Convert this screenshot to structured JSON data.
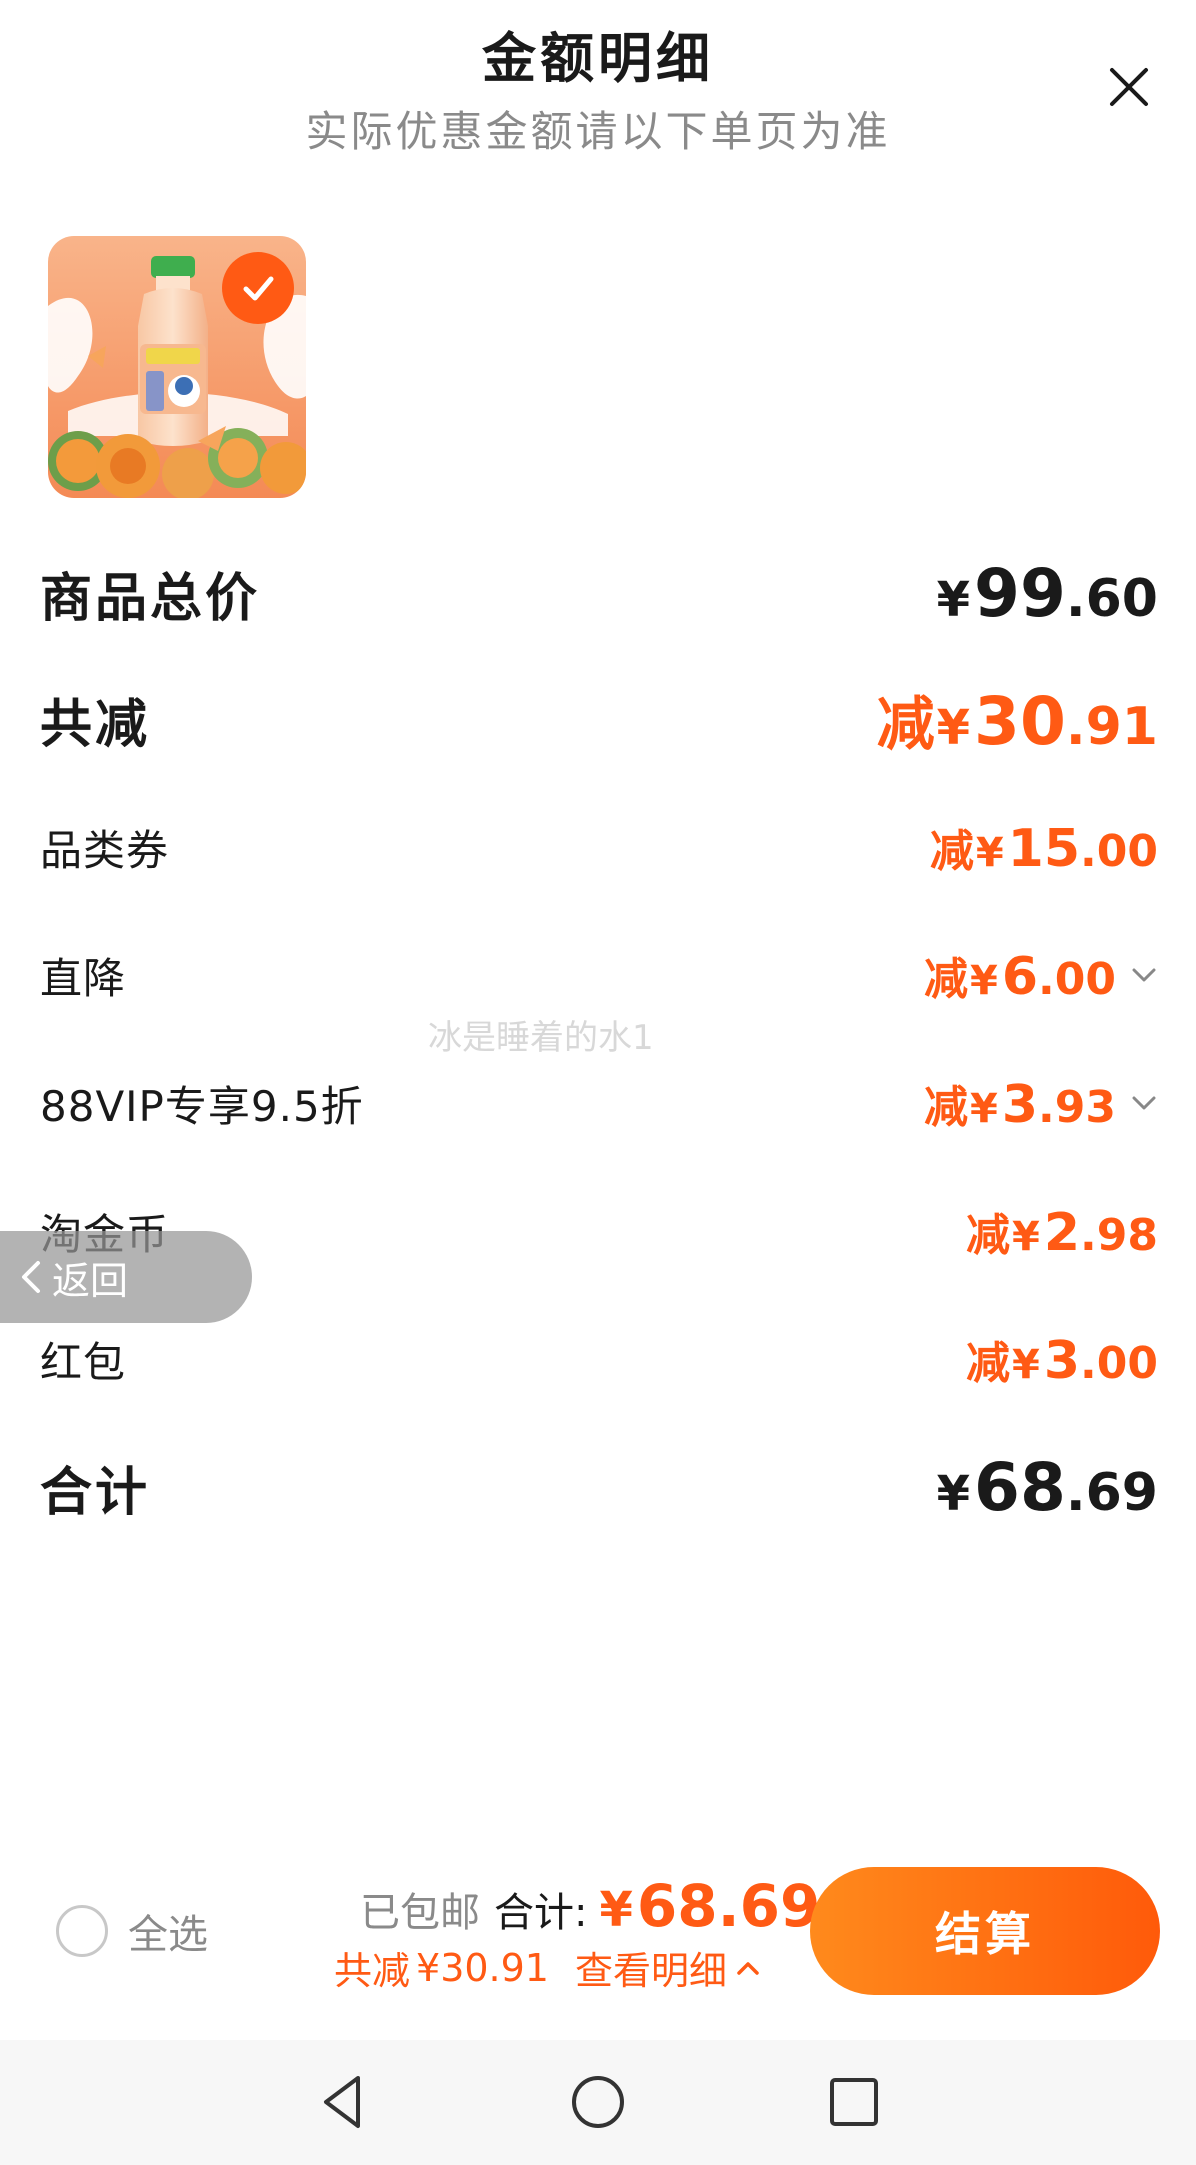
{
  "header": {
    "title": "金额明细",
    "subtitle": "实际优惠金额请以下单页为准",
    "close_icon": "close-icon"
  },
  "product": {
    "image_icon": "melon-milk-drink-image",
    "selected": true
  },
  "rows": {
    "subtotal": {
      "label": "商品总价",
      "currency": "¥",
      "int": "99",
      "dec": ".60"
    },
    "discount_total": {
      "label": "共减",
      "prefix": "减",
      "currency": "¥",
      "int": "30",
      "dec": ".91"
    },
    "category_coupon": {
      "label": "品类券",
      "prefix": "减",
      "currency": "¥",
      "int": "15",
      "dec": ".00"
    },
    "direct_discount": {
      "label": "直降",
      "prefix": "减",
      "currency": "¥",
      "int": "6",
      "dec": ".00"
    },
    "vip_discount": {
      "label": "88VIP专享9.5折",
      "prefix": "减",
      "currency": "¥",
      "int": "3",
      "dec": ".93"
    },
    "coins": {
      "label": "淘金币",
      "prefix": "减",
      "currency": "¥",
      "int": "2",
      "dec": ".98"
    },
    "red_packet": {
      "label": "红包",
      "prefix": "减",
      "currency": "¥",
      "int": "3",
      "dec": ".00"
    },
    "total": {
      "label": "合计",
      "currency": "¥",
      "int": "68",
      "dec": ".69"
    }
  },
  "watermark": "冰是睡着的水1",
  "back_button": {
    "label": "返回"
  },
  "bottom_bar": {
    "select_all_label": "全选",
    "shipping_label": "已包邮",
    "total_label": "合计:",
    "total_currency": "¥",
    "total_value": "68.69",
    "discount_label": "共减",
    "discount_value": "¥30.91",
    "details_link": "查看明细",
    "checkout_label": "结算"
  },
  "colors": {
    "accent": "#ff5a14",
    "text": "#1a1a1a",
    "muted": "#8a8a8a"
  }
}
